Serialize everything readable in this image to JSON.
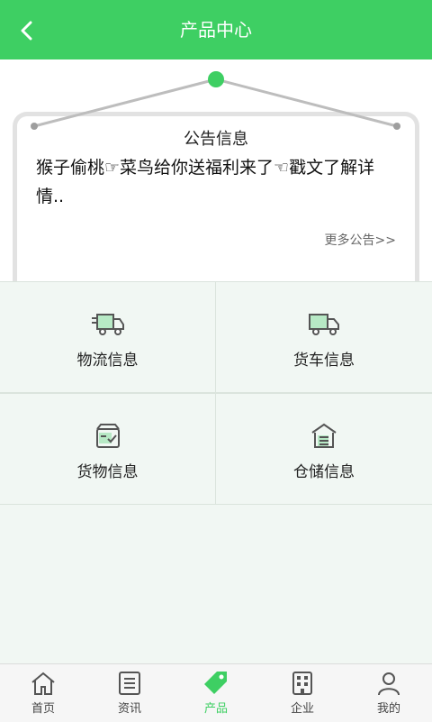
{
  "header": {
    "title": "产品中心",
    "back_icon": "chevron-left-icon"
  },
  "notice": {
    "title": "公告信息",
    "body": "猴子偷桃☞菜鸟给你送福利来了☜戳文了解详情..",
    "more": "更多公告>>"
  },
  "grid": {
    "items": [
      {
        "label": "物流信息",
        "icon": "delivery-truck-icon"
      },
      {
        "label": "货车信息",
        "icon": "truck-icon"
      },
      {
        "label": "货物信息",
        "icon": "cargo-box-icon"
      },
      {
        "label": "仓储信息",
        "icon": "warehouse-icon"
      }
    ]
  },
  "tabbar": {
    "items": [
      {
        "label": "首页",
        "icon": "home-icon",
        "active": false
      },
      {
        "label": "资讯",
        "icon": "news-icon",
        "active": false
      },
      {
        "label": "产品",
        "icon": "tag-icon",
        "active": true
      },
      {
        "label": "企业",
        "icon": "building-icon",
        "active": false
      },
      {
        "label": "我的",
        "icon": "user-icon",
        "active": false
      }
    ]
  },
  "colors": {
    "brand": "#3ecf63",
    "icon": "#555555"
  }
}
